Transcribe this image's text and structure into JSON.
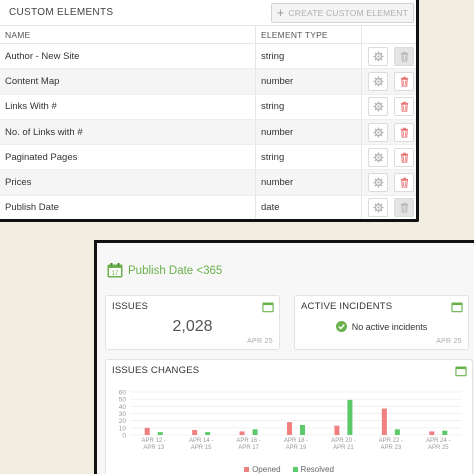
{
  "custom_elements": {
    "title": "CUSTOM ELEMENTS",
    "create_button": "CREATE CUSTOM ELEMENT",
    "columns": {
      "name": "NAME",
      "type": "ELEMENT TYPE"
    },
    "rows": [
      {
        "name": "Author - New Site",
        "type": "string",
        "delete_enabled": false
      },
      {
        "name": "Content Map",
        "type": "number",
        "delete_enabled": true
      },
      {
        "name": "Links With #",
        "type": "string",
        "delete_enabled": true
      },
      {
        "name": "No. of Links with #",
        "type": "number",
        "delete_enabled": true
      },
      {
        "name": "Paginated Pages",
        "type": "string",
        "delete_enabled": true
      },
      {
        "name": "Prices",
        "type": "number",
        "delete_enabled": true
      },
      {
        "name": "Publish Date",
        "type": "date",
        "delete_enabled": false
      }
    ]
  },
  "dashboard": {
    "title": "Publish Date <365",
    "issues": {
      "label": "ISSUES",
      "value": "2,028",
      "date": "APR 25"
    },
    "incidents": {
      "label": "ACTIVE INCIDENTS",
      "status": "No active incidents",
      "date": "APR 25"
    },
    "changes": {
      "label": "ISSUES CHANGES"
    }
  },
  "colors": {
    "accent_green": "#6ab04c",
    "opened": "#f08080",
    "resolved": "#5cc96b",
    "delete_red": "#e87070"
  },
  "chart_data": {
    "type": "bar",
    "title": "ISSUES CHANGES",
    "ylim": [
      0,
      60
    ],
    "yticks": [
      "0",
      "10",
      "20",
      "30",
      "40",
      "50",
      "60"
    ],
    "categories": [
      [
        "APR 12 -",
        "APR 13"
      ],
      [
        "APR 14 -",
        "APR 15"
      ],
      [
        "APR 16 -",
        "APR 17"
      ],
      [
        "APR 18 -",
        "APR 19"
      ],
      [
        "APR 20 -",
        "APR 21"
      ],
      [
        "APR 22 -",
        "APR 23"
      ],
      [
        "APR 24 -",
        "APR 25"
      ]
    ],
    "series": [
      {
        "name": "Opened",
        "color": "#f08080",
        "values": [
          10,
          7,
          5,
          18,
          13,
          37,
          5
        ]
      },
      {
        "name": "Resolved",
        "color": "#5cc96b",
        "values": [
          4,
          4,
          8,
          14,
          49,
          8,
          6
        ]
      }
    ],
    "legend": "bottom"
  }
}
